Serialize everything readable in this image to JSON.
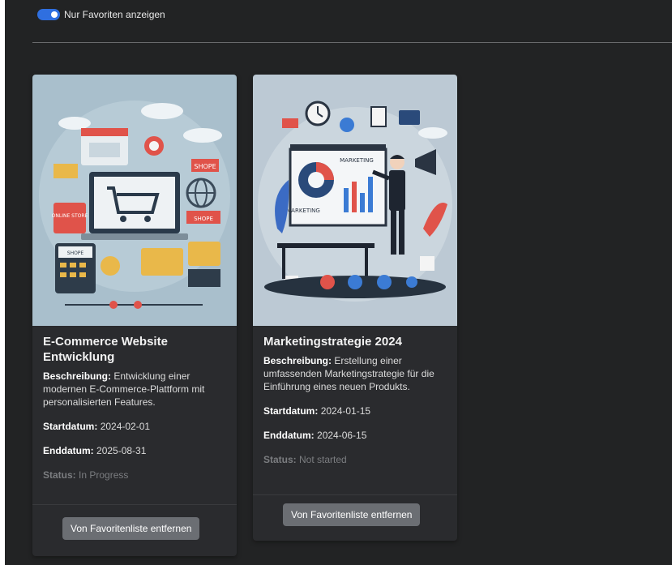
{
  "filter": {
    "toggle_label": "Nur Favoriten anzeigen",
    "toggle_on": true
  },
  "colors": {
    "background": "#222324",
    "card": "#2a2b2e",
    "toggle_accent": "#2f6fe0",
    "button": "#6b6e73",
    "status_text": "#7b7d80"
  },
  "projects": [
    {
      "title": "E-Commerce Website Entwicklung",
      "image_icon": "ecommerce-illustration",
      "image_texts": [
        "ONLINE STORE",
        "SHOPE",
        "SHOPE",
        "SHOPE"
      ],
      "description_label": "Beschreibung:",
      "description": "Entwicklung einer modernen E-Commerce-Plattform mit personalisierten Features.",
      "start_label": "Startdatum:",
      "start": "2024-02-01",
      "end_label": "Enddatum:",
      "end": "2025-08-31",
      "status_label": "Status:",
      "status": "In Progress",
      "button_label": "Von Favoritenliste entfernen"
    },
    {
      "title": "Marketingstrategie 2024",
      "image_icon": "marketing-illustration",
      "image_texts": [
        "MARKETING",
        "MARKETING"
      ],
      "description_label": "Beschreibung:",
      "description": "Erstellung einer umfassenden Marketingstrategie für die Einführung eines neuen Produkts.",
      "start_label": "Startdatum:",
      "start": "2024-01-15",
      "end_label": "Enddatum:",
      "end": "2024-06-15",
      "status_label": "Status:",
      "status": "Not started",
      "button_label": "Von Favoritenliste entfernen"
    }
  ]
}
